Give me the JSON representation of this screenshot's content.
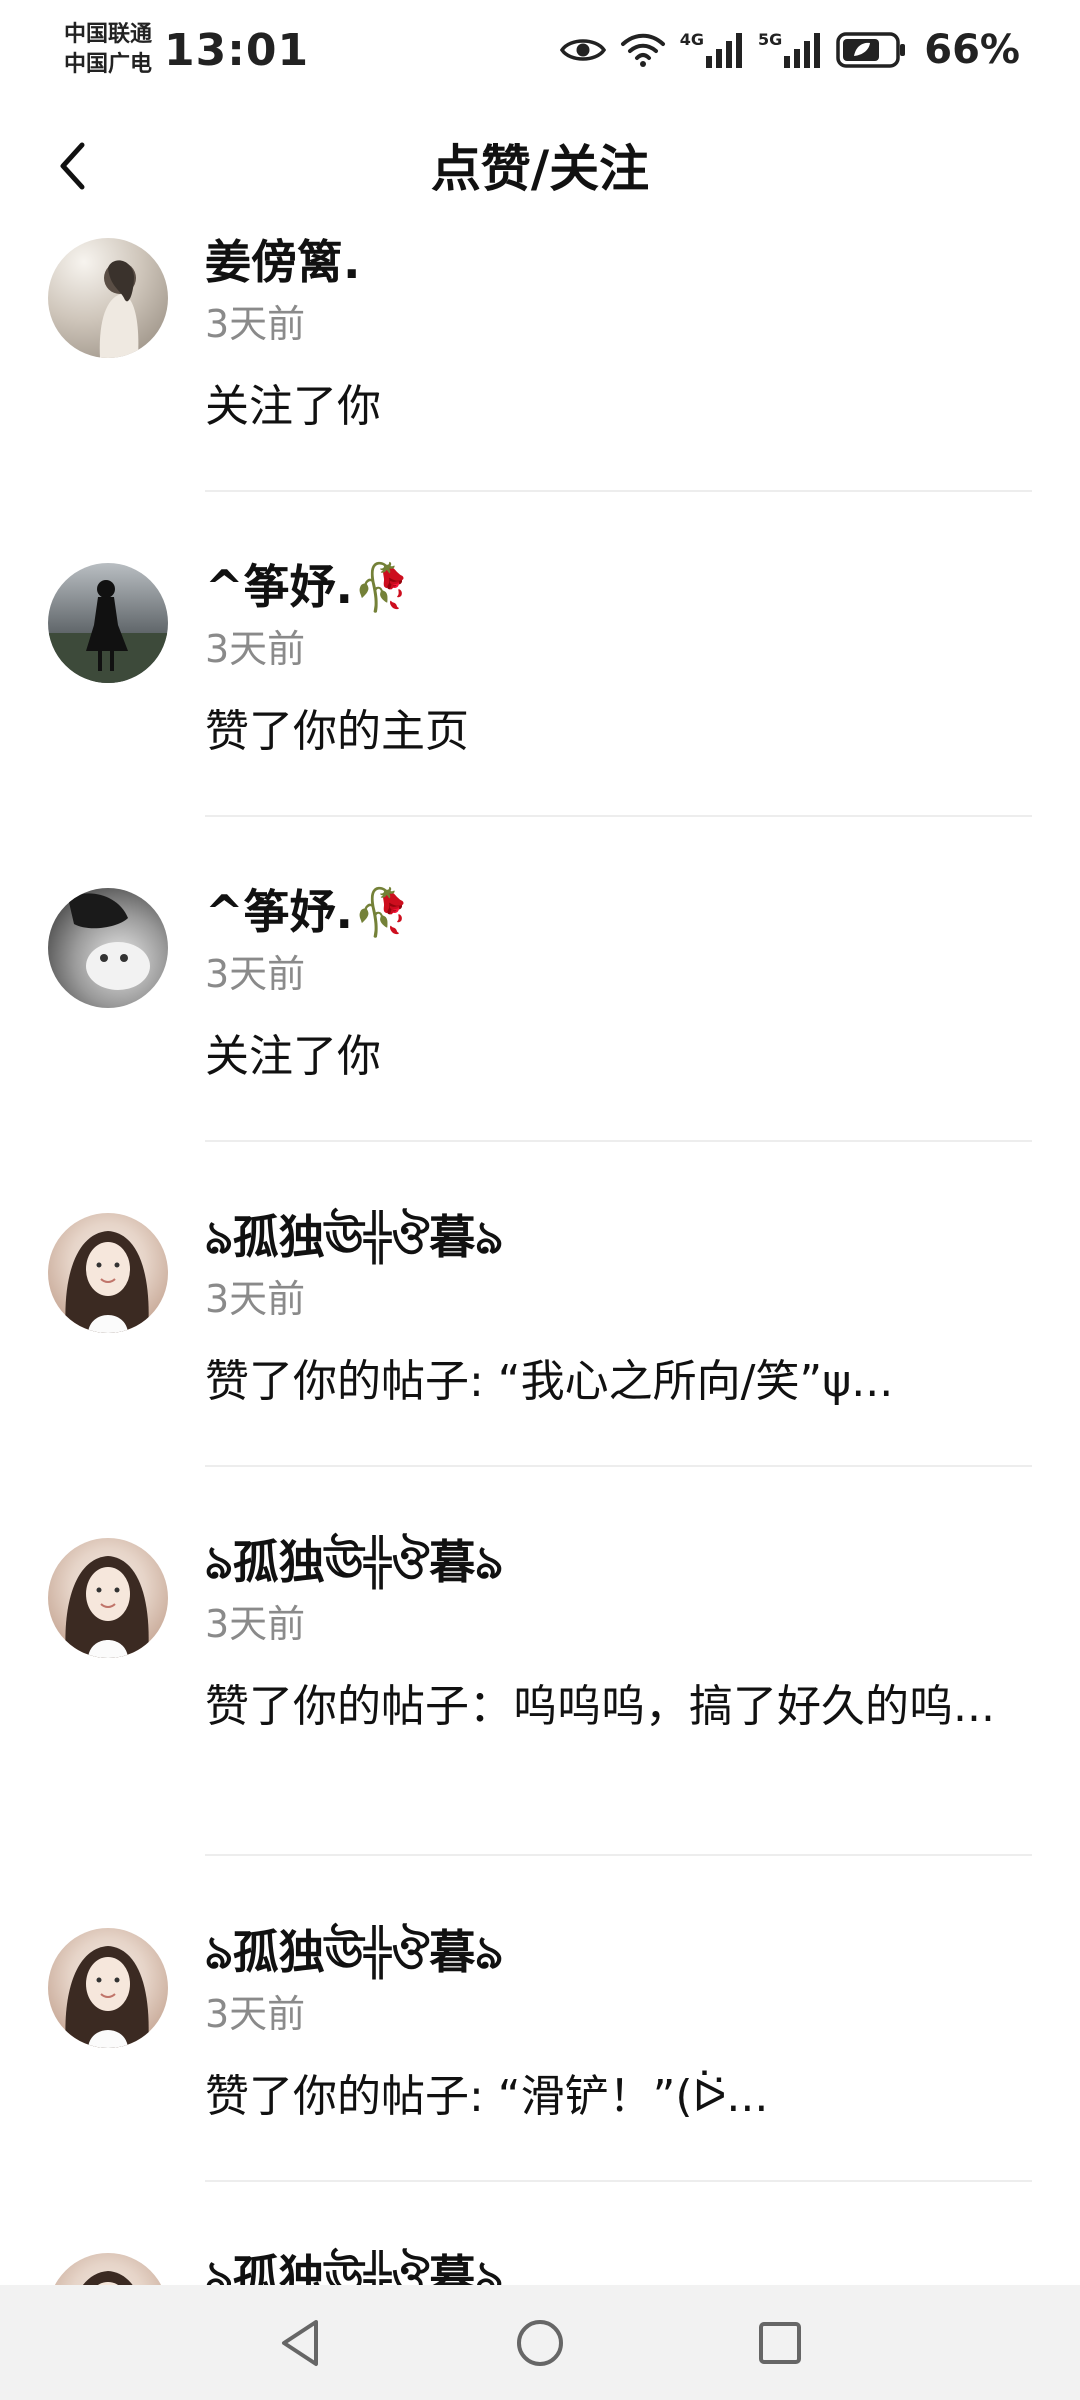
{
  "status_bar": {
    "carrier_1": "中国联通",
    "carrier_2": "中国广电",
    "time": "13:01",
    "net_1": "4G",
    "net_2": "5G",
    "battery": "66%",
    "icons": [
      "eye-icon",
      "wifi-icon",
      "signal-icon",
      "battery-icon"
    ]
  },
  "header": {
    "title": "点赞/关注",
    "back_icon": "chevron-left-icon"
  },
  "notifications": [
    {
      "name": "姜傍篱.",
      "time": "3天前",
      "message": "关注了你"
    },
    {
      "name": "^筝妤.🥀",
      "time": "3天前",
      "message": "赞了你的主页"
    },
    {
      "name": "^筝妤.🥀",
      "time": "3天前",
      "message": "关注了你"
    },
    {
      "name": "ঌ孤独ঊ╬ঔ暮ঌ",
      "time": "3天前",
      "message": "赞了你的帖子: “我心之所向/笑”ψ..."
    },
    {
      "name": "ঌ孤独ঊ╬ঔ暮ঌ",
      "time": "3天前",
      "message": "赞了你的帖子：呜呜呜，搞了好久的呜..."
    },
    {
      "name": "ঌ孤独ঊ╬ঔ暮ঌ",
      "time": "3天前",
      "message": "赞了你的帖子: “滑铲！”(ᐖ..."
    },
    {
      "name": "ঌ孤独ঊ╬ঔ暮ঌ",
      "time": "",
      "message": ""
    }
  ],
  "nav_bar": {
    "icons": [
      "back-triangle-icon",
      "home-circle-icon",
      "recents-square-icon"
    ]
  },
  "colors": {
    "text_primary": "#111111",
    "text_secondary": "#8a8a8a",
    "divider": "#ededed",
    "nav_bar_bg": "#f2f2f2"
  }
}
